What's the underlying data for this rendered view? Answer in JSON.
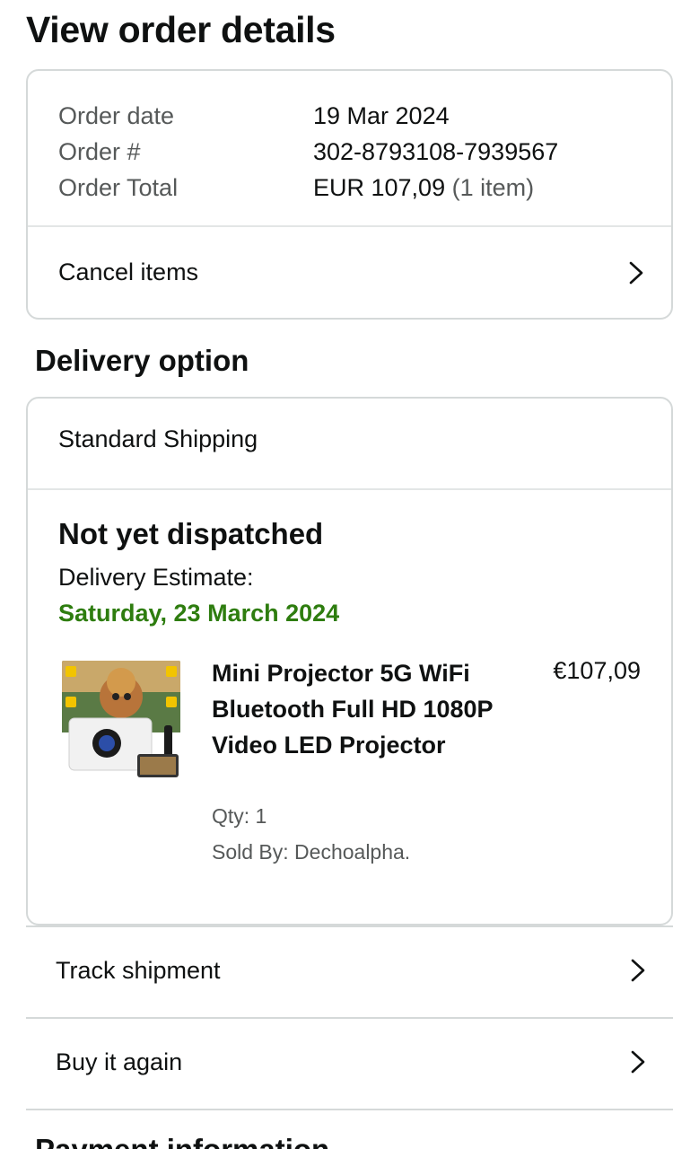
{
  "page": {
    "title": "View order details"
  },
  "summary": {
    "rows": [
      {
        "label": "Order date",
        "value": "19 Mar 2024",
        "sub": ""
      },
      {
        "label": "Order #",
        "value": "302-8793108-7939567",
        "sub": ""
      },
      {
        "label": "Order Total",
        "value": "EUR 107,09",
        "sub": "(1 item)"
      }
    ],
    "cancel_label": "Cancel items"
  },
  "delivery": {
    "section_title": "Delivery option",
    "shipping_method": "Standard Shipping",
    "status": "Not yet dispatched",
    "estimate_label": "Delivery Estimate:",
    "estimate_date": "Saturday, 23 March 2024",
    "estimate_color": "#2e7d0f"
  },
  "product": {
    "title": "Mini Projector 5G WiFi Bluetooth Full HD 1080P Video LED Projector",
    "price": "€107,09",
    "qty": "Qty: 1",
    "seller": "Sold By: Dechoalpha."
  },
  "actions": {
    "track_label": "Track shipment",
    "buy_again_label": "Buy it again"
  },
  "payment": {
    "section_title": "Payment information"
  },
  "icons": {
    "chevron": "chevron-right-icon"
  }
}
